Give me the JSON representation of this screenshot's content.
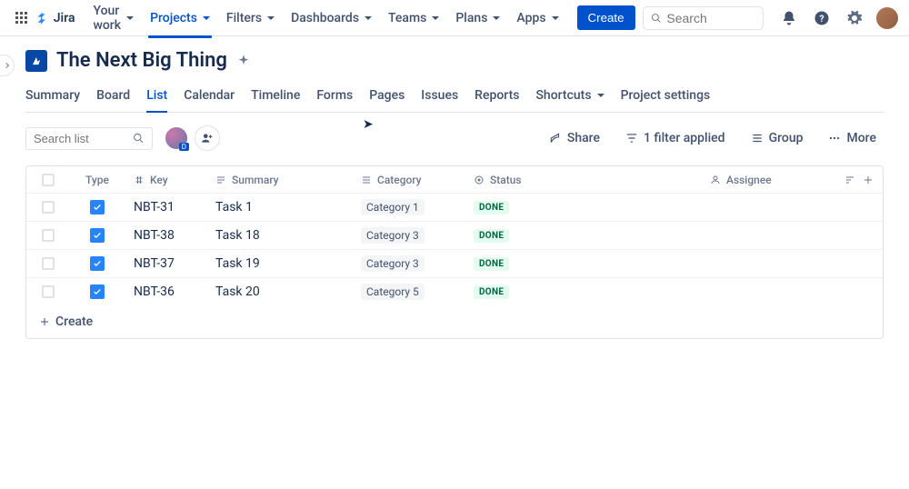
{
  "brand": "Jira",
  "nav": {
    "your_work": "Your work",
    "projects": "Projects",
    "filters": "Filters",
    "dashboards": "Dashboards",
    "teams": "Teams",
    "plans": "Plans",
    "apps": "Apps",
    "create": "Create"
  },
  "search": {
    "placeholder": "Search"
  },
  "project": {
    "title": "The Next Big Thing"
  },
  "tabs": {
    "summary": "Summary",
    "board": "Board",
    "list": "List",
    "calendar": "Calendar",
    "timeline": "Timeline",
    "forms": "Forms",
    "pages": "Pages",
    "issues": "Issues",
    "reports": "Reports",
    "shortcuts": "Shortcuts",
    "project_settings": "Project settings"
  },
  "list_search": {
    "placeholder": "Search list"
  },
  "avatar_badge": "D",
  "toolbar": {
    "share": "Share",
    "filter_applied": "1 filter applied",
    "group": "Group",
    "more": "More"
  },
  "columns": {
    "type": "Type",
    "key": "Key",
    "summary": "Summary",
    "category": "Category",
    "status": "Status",
    "assignee": "Assignee"
  },
  "rows": [
    {
      "key": "NBT-31",
      "summary": "Task 1",
      "category": "Category 1",
      "status": "DONE"
    },
    {
      "key": "NBT-38",
      "summary": "Task 18",
      "category": "Category 3",
      "status": "DONE"
    },
    {
      "key": "NBT-37",
      "summary": "Task 19",
      "category": "Category 3",
      "status": "DONE"
    },
    {
      "key": "NBT-36",
      "summary": "Task 20",
      "category": "Category 5",
      "status": "DONE"
    }
  ],
  "create_label": "Create"
}
